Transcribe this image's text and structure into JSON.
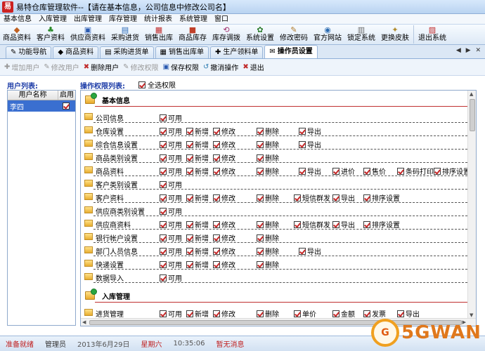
{
  "window": {
    "title": "易特仓库管理软件--【请在基本信息，公司信息中修改公司名】",
    "logo": "易"
  },
  "menu": [
    "基本信息",
    "入库管理",
    "出库管理",
    "库存管理",
    "统计报表",
    "系统管理",
    "窗口"
  ],
  "toolbar": [
    {
      "label": "商品资料",
      "icon": "◆"
    },
    {
      "label": "客户资料",
      "icon": "♣"
    },
    {
      "label": "供应商资料",
      "icon": "▣"
    },
    {
      "label": "采购进货",
      "icon": "▤"
    },
    {
      "label": "销售出库",
      "icon": "▦"
    },
    {
      "label": "商品库存",
      "icon": "■"
    },
    {
      "label": "库存调拨",
      "icon": "⟲"
    },
    {
      "label": "系统设置",
      "icon": "✿"
    },
    {
      "label": "修改密码",
      "icon": "✎"
    },
    {
      "label": "官方网站",
      "icon": "◉"
    },
    {
      "label": "锁定系统",
      "icon": "▥"
    },
    {
      "label": "更换皮肤",
      "icon": "✦"
    },
    {
      "label": "退出系统",
      "icon": "▨"
    }
  ],
  "tabs": [
    {
      "label": "功能导航",
      "icon": "✎",
      "active": false
    },
    {
      "label": "商品资料",
      "icon": "◆",
      "active": false
    },
    {
      "label": "采购进货单",
      "icon": "▤",
      "active": false
    },
    {
      "label": "销售出库单",
      "icon": "▦",
      "active": false
    },
    {
      "label": "生产领料单",
      "icon": "✚",
      "active": false
    },
    {
      "label": "操作员设置",
      "icon": "✉",
      "active": true
    }
  ],
  "tab_nav": "◀ ▶ ✕",
  "ops": [
    {
      "label": "增加用户",
      "icon": "✚",
      "disabled": true
    },
    {
      "label": "修改用户",
      "icon": "✎",
      "disabled": true
    },
    {
      "label": "删除用户",
      "icon": "✖",
      "disabled": false
    },
    {
      "label": "修改权限",
      "icon": "✎",
      "disabled": true
    },
    {
      "label": "保存权限",
      "icon": "▣",
      "disabled": false
    },
    {
      "label": "撤消操作",
      "icon": "↺",
      "disabled": false
    },
    {
      "label": "退出",
      "icon": "✖",
      "disabled": false
    }
  ],
  "users_title": "用户列表:",
  "perm_title": "操作权限列表:",
  "select_all": "全选权限",
  "user_cols": [
    "用户名称",
    "启用"
  ],
  "users": [
    {
      "name": "李四",
      "enabled": true
    }
  ],
  "groups": [
    {
      "title": "基本信息",
      "rows": [
        {
          "name": "公司信息",
          "perms": [
            "可用"
          ]
        },
        {
          "name": "仓库设置",
          "perms": [
            "可用",
            "新增",
            "修改",
            "删除",
            "导出"
          ]
        },
        {
          "name": "综合信息设置",
          "perms": [
            "可用",
            "新增",
            "修改",
            "删除",
            "导出"
          ]
        },
        {
          "name": "商品类别设置",
          "perms": [
            "可用",
            "新增",
            "修改",
            "删除"
          ]
        },
        {
          "name": "商品资料",
          "perms": [
            "可用",
            "新增",
            "修改",
            "删除",
            "导出",
            "进价",
            "售价",
            "条码打印",
            "排序设置"
          ]
        },
        {
          "name": "客户类别设置",
          "perms": [
            "可用"
          ]
        },
        {
          "name": "客户资料",
          "perms": [
            "可用",
            "新增",
            "修改",
            "删除",
            "短信群发",
            "导出",
            "排序设置"
          ]
        },
        {
          "name": "供应商类别设置",
          "perms": [
            "可用"
          ]
        },
        {
          "name": "供应商资料",
          "perms": [
            "可用",
            "新增",
            "修改",
            "删除",
            "短信群发",
            "导出",
            "排序设置"
          ]
        },
        {
          "name": "银行帐户设置",
          "perms": [
            "可用",
            "新增",
            "修改",
            "删除"
          ]
        },
        {
          "name": "部门人员信息",
          "perms": [
            "可用",
            "新增",
            "修改",
            "删除",
            "导出"
          ]
        },
        {
          "name": "快递设置",
          "perms": [
            "可用",
            "新增",
            "修改",
            "删除"
          ]
        },
        {
          "name": "数据导入",
          "perms": [
            "可用"
          ]
        }
      ]
    },
    {
      "title": "入库管理",
      "rows": [
        {
          "name": "进货管理",
          "perms": [
            "可用",
            "新增",
            "修改",
            "删除",
            "单价",
            "金额",
            "发票",
            "导出"
          ]
        }
      ]
    }
  ],
  "status": [
    "准备就绪",
    "管理员",
    "2013年6月29日",
    "星期六",
    "10:35:06",
    "暂无消息"
  ],
  "watermark": {
    "circle": "G",
    "text": "5GWAN"
  }
}
